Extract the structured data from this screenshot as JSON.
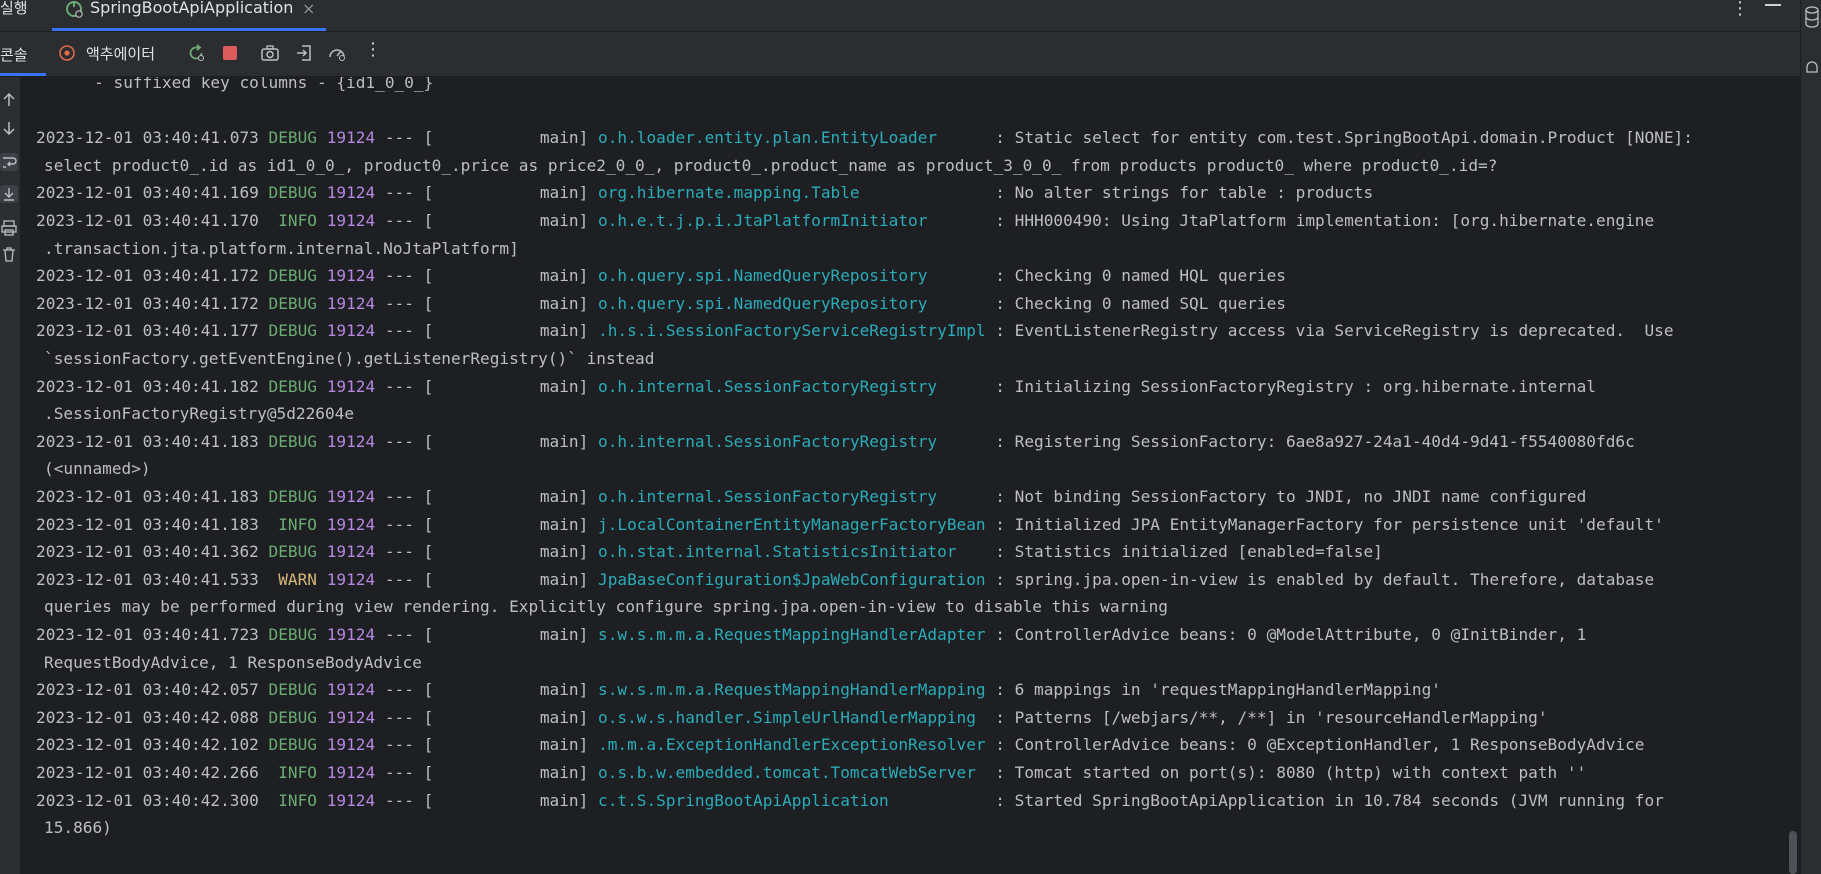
{
  "run_panel": {
    "label": "실행",
    "tab": {
      "title": "SpringBootApiApplication",
      "close": "×"
    }
  },
  "toolbar": {
    "console_label": "콘솔",
    "actuator_label": "액추에이터",
    "icons": [
      "rerun-icon",
      "stop-icon",
      "camera-icon",
      "exit-icon",
      "profiler-icon",
      "more-vert-icon"
    ]
  },
  "colors": {
    "accent": "#3574f0",
    "debug": "#6aab73",
    "warn": "#d5b778",
    "pid": "#b587e0",
    "logger": "#2aacb8",
    "text": "#bcbec4"
  },
  "log": {
    "header_line": "      - suffixed key columns - {id1_0_0_}",
    "entries": [
      {
        "ts": "2023-12-01 03:40:41.073",
        "level": "DEBUG",
        "pid": "19124",
        "sep": "--- [",
        "thread": "main]",
        "logger": "o.h.loader.entity.plan.EntityLoader",
        "msg": ": Static select for entity com.test.SpringBootApi.domain.Product [NONE]:",
        "cont": "select product0_.id as id1_0_0_, product0_.price as price2_0_0_, product0_.product_name as product_3_0_0_ from products product0_ where product0_.id=?"
      },
      {
        "ts": "2023-12-01 03:40:41.169",
        "level": "DEBUG",
        "pid": "19124",
        "sep": "--- [",
        "thread": "main]",
        "logger": "org.hibernate.mapping.Table",
        "msg": ": No alter strings for table : products"
      },
      {
        "ts": "2023-12-01 03:40:41.170",
        "level": "INFO",
        "pid": "19124",
        "sep": "--- [",
        "thread": "main]",
        "logger": "o.h.e.t.j.p.i.JtaPlatformInitiator",
        "msg": ": HHH000490: Using JtaPlatform implementation: [org.hibernate.engine",
        "cont": ".transaction.jta.platform.internal.NoJtaPlatform]"
      },
      {
        "ts": "2023-12-01 03:40:41.172",
        "level": "DEBUG",
        "pid": "19124",
        "sep": "--- [",
        "thread": "main]",
        "logger": "o.h.query.spi.NamedQueryRepository",
        "msg": ": Checking 0 named HQL queries"
      },
      {
        "ts": "2023-12-01 03:40:41.172",
        "level": "DEBUG",
        "pid": "19124",
        "sep": "--- [",
        "thread": "main]",
        "logger": "o.h.query.spi.NamedQueryRepository",
        "msg": ": Checking 0 named SQL queries"
      },
      {
        "ts": "2023-12-01 03:40:41.177",
        "level": "DEBUG",
        "pid": "19124",
        "sep": "--- [",
        "thread": "main]",
        "logger": ".h.s.i.SessionFactoryServiceRegistryImpl",
        "msg": ": EventListenerRegistry access via ServiceRegistry is deprecated.  Use",
        "cont": "`sessionFactory.getEventEngine().getListenerRegistry()` instead"
      },
      {
        "ts": "2023-12-01 03:40:41.182",
        "level": "DEBUG",
        "pid": "19124",
        "sep": "--- [",
        "thread": "main]",
        "logger": "o.h.internal.SessionFactoryRegistry",
        "msg": ": Initializing SessionFactoryRegistry : org.hibernate.internal",
        "cont": ".SessionFactoryRegistry@5d22604e"
      },
      {
        "ts": "2023-12-01 03:40:41.183",
        "level": "DEBUG",
        "pid": "19124",
        "sep": "--- [",
        "thread": "main]",
        "logger": "o.h.internal.SessionFactoryRegistry",
        "msg": ": Registering SessionFactory: 6ae8a927-24a1-40d4-9d41-f5540080fd6c",
        "cont": "(<unnamed>)"
      },
      {
        "ts": "2023-12-01 03:40:41.183",
        "level": "DEBUG",
        "pid": "19124",
        "sep": "--- [",
        "thread": "main]",
        "logger": "o.h.internal.SessionFactoryRegistry",
        "msg": ": Not binding SessionFactory to JNDI, no JNDI name configured"
      },
      {
        "ts": "2023-12-01 03:40:41.183",
        "level": "INFO",
        "pid": "19124",
        "sep": "--- [",
        "thread": "main]",
        "logger": "j.LocalContainerEntityManagerFactoryBean",
        "msg": ": Initialized JPA EntityManagerFactory for persistence unit 'default'"
      },
      {
        "ts": "2023-12-01 03:40:41.362",
        "level": "DEBUG",
        "pid": "19124",
        "sep": "--- [",
        "thread": "main]",
        "logger": "o.h.stat.internal.StatisticsInitiator",
        "msg": ": Statistics initialized [enabled=false]"
      },
      {
        "ts": "2023-12-01 03:40:41.533",
        "level": "WARN",
        "pid": "19124",
        "sep": "--- [",
        "thread": "main]",
        "logger": "JpaBaseConfiguration$JpaWebConfiguration",
        "msg": ": spring.jpa.open-in-view is enabled by default. Therefore, database",
        "cont": "queries may be performed during view rendering. Explicitly configure spring.jpa.open-in-view to disable this warning"
      },
      {
        "ts": "2023-12-01 03:40:41.723",
        "level": "DEBUG",
        "pid": "19124",
        "sep": "--- [",
        "thread": "main]",
        "logger": "s.w.s.m.m.a.RequestMappingHandlerAdapter",
        "msg": ": ControllerAdvice beans: 0 @ModelAttribute, 0 @InitBinder, 1",
        "cont": "RequestBodyAdvice, 1 ResponseBodyAdvice"
      },
      {
        "ts": "2023-12-01 03:40:42.057",
        "level": "DEBUG",
        "pid": "19124",
        "sep": "--- [",
        "thread": "main]",
        "logger": "s.w.s.m.m.a.RequestMappingHandlerMapping",
        "msg": ": 6 mappings in 'requestMappingHandlerMapping'"
      },
      {
        "ts": "2023-12-01 03:40:42.088",
        "level": "DEBUG",
        "pid": "19124",
        "sep": "--- [",
        "thread": "main]",
        "logger": "o.s.w.s.handler.SimpleUrlHandlerMapping",
        "msg": ": Patterns [/webjars/**, /**] in 'resourceHandlerMapping'"
      },
      {
        "ts": "2023-12-01 03:40:42.102",
        "level": "DEBUG",
        "pid": "19124",
        "sep": "--- [",
        "thread": "main]",
        "logger": ".m.m.a.ExceptionHandlerExceptionResolver",
        "msg": ": ControllerAdvice beans: 0 @ExceptionHandler, 1 ResponseBodyAdvice"
      },
      {
        "ts": "2023-12-01 03:40:42.266",
        "level": "INFO",
        "pid": "19124",
        "sep": "--- [",
        "thread": "main]",
        "logger": "o.s.b.w.embedded.tomcat.TomcatWebServer",
        "msg": ": Tomcat started on port(s): 8080 (http) with context path ''"
      },
      {
        "ts": "2023-12-01 03:40:42.300",
        "level": "INFO",
        "pid": "19124",
        "sep": "--- [",
        "thread": "main]",
        "logger": "c.t.S.SpringBootApiApplication",
        "msg": ": Started SpringBootApiApplication in 10.784 seconds (JVM running for",
        "cont": "15.866)"
      }
    ]
  }
}
